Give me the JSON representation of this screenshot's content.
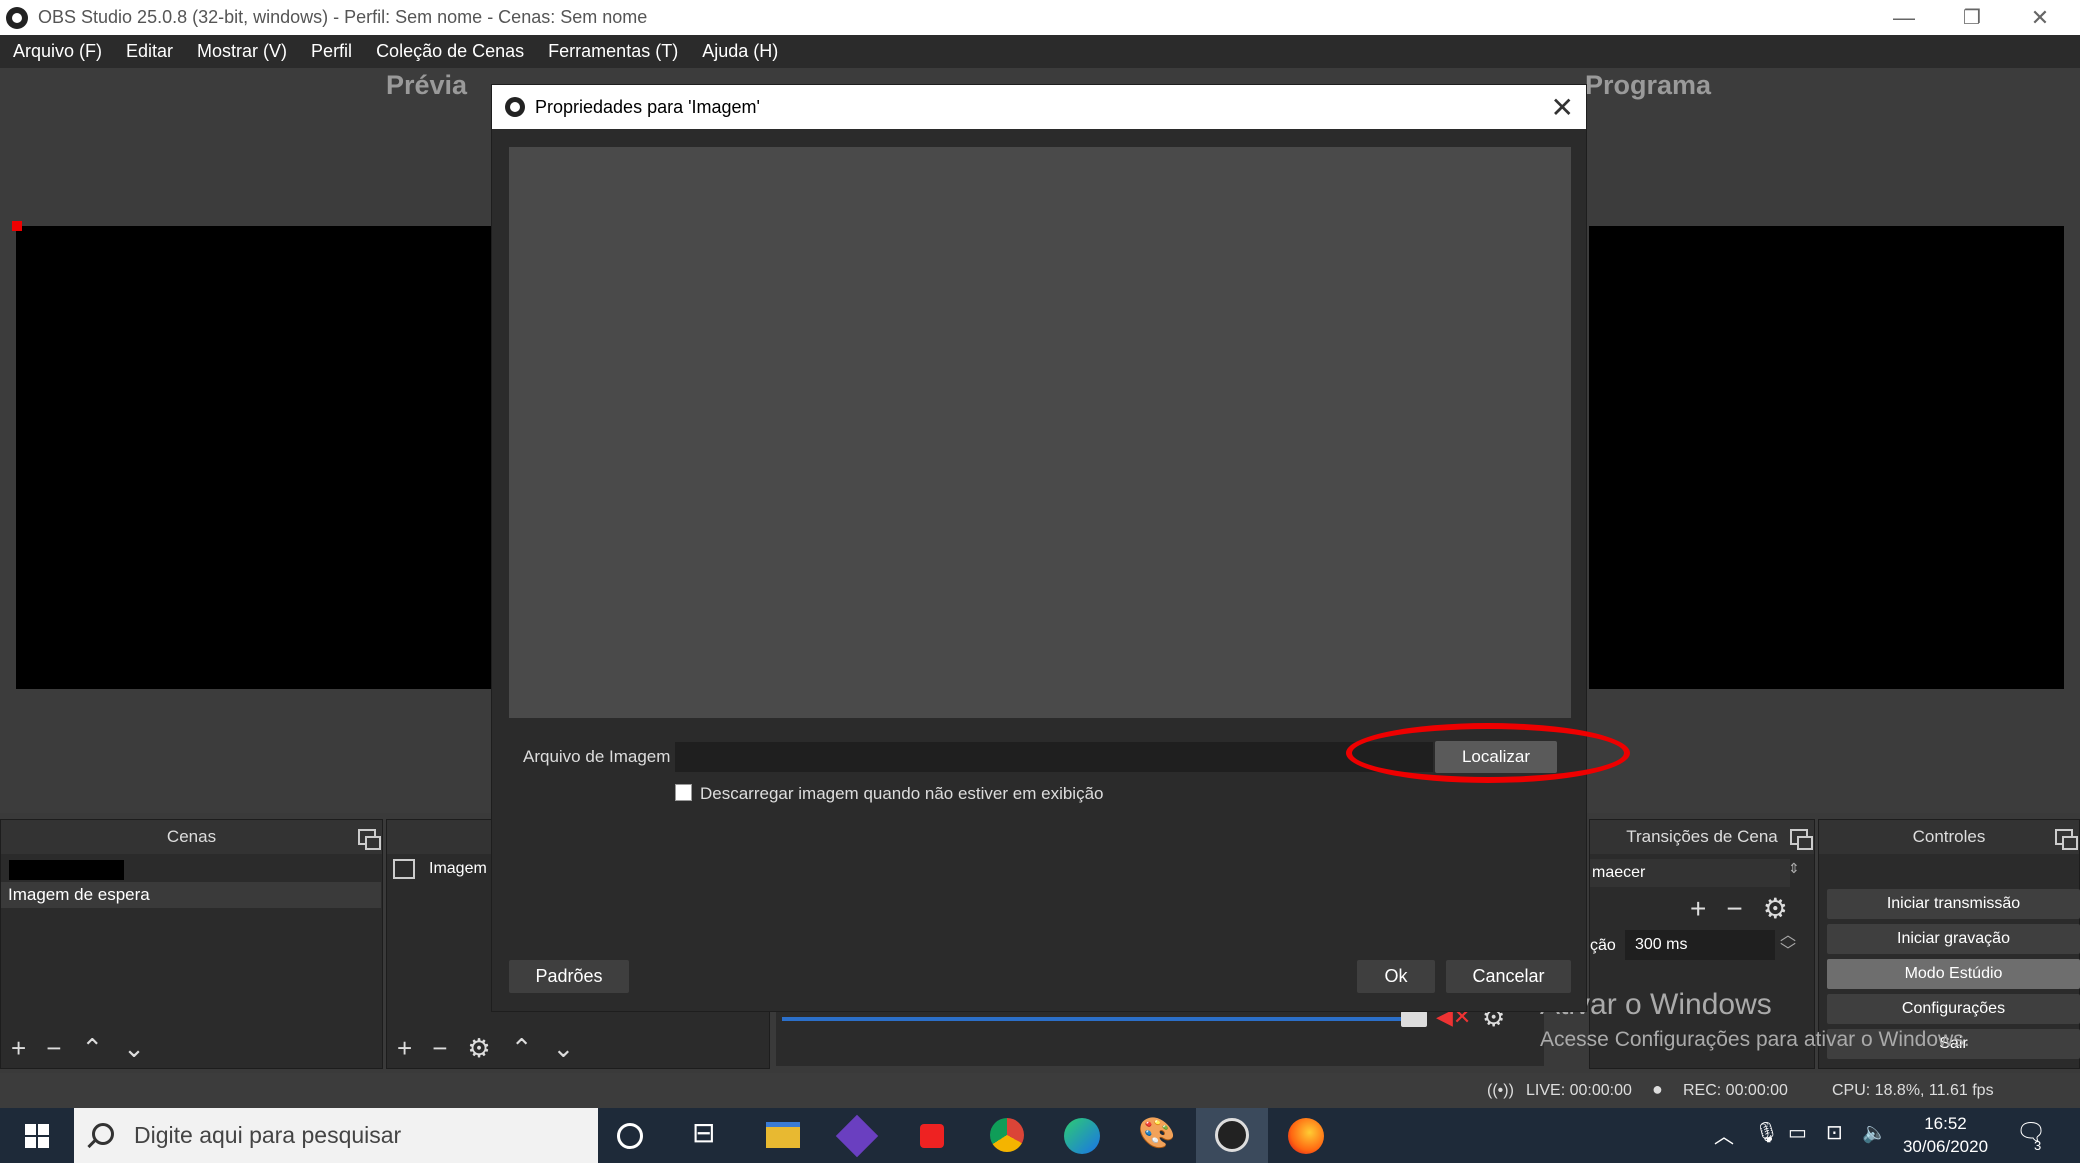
{
  "window": {
    "title": "OBS Studio 25.0.8 (32-bit, windows) - Perfil: Sem nome - Cenas: Sem nome",
    "minimize": "—",
    "restore": "❐",
    "close": "✕"
  },
  "menu": [
    "Arquivo (F)",
    "Editar",
    "Mostrar (V)",
    "Perfil",
    "Coleção de Cenas",
    "Ferramentas (T)",
    "Ajuda (H)"
  ],
  "preview_label": "Prévia",
  "program_label": "Programa",
  "scenes_dock": {
    "title": "Cenas",
    "items": [
      "Imagem de espera"
    ]
  },
  "sources_dock": {
    "items": [
      "Imagem"
    ]
  },
  "transitions_dock": {
    "title": "Transições de Cena",
    "transition_value": "maecer",
    "duration_label": "ção",
    "duration_value": "300 ms"
  },
  "controls_dock": {
    "title": "Controles",
    "buttons": [
      "Iniciar transmissão",
      "Iniciar gravação",
      "Modo Estúdio",
      "Configurações",
      "Sair"
    ],
    "active_button": "Modo Estúdio"
  },
  "dialog": {
    "title": "Propriedades para 'Imagem'",
    "field_label": "Arquivo de Imagem",
    "field_value": "",
    "browse_button": "Localizar",
    "checkbox_label": "Descarregar imagem quando não estiver em exibição",
    "checkbox_checked": false,
    "defaults_button": "Padrões",
    "ok_button": "Ok",
    "cancel_button": "Cancelar"
  },
  "watermark": {
    "line1": "Ativar o Windows",
    "line2": "Acesse Configurações para ativar o Windows."
  },
  "status": {
    "live": "LIVE: 00:00:00",
    "rec": "REC: 00:00:00",
    "cpu": "CPU: 18.8%, 11.61 fps"
  },
  "taskbar": {
    "search_placeholder": "Digite aqui para pesquisar",
    "time": "16:52",
    "date": "30/06/2020",
    "notification_count": "3"
  },
  "colors": {
    "annotation": "#e00000",
    "mixer_bar": "#2b6fc9"
  }
}
